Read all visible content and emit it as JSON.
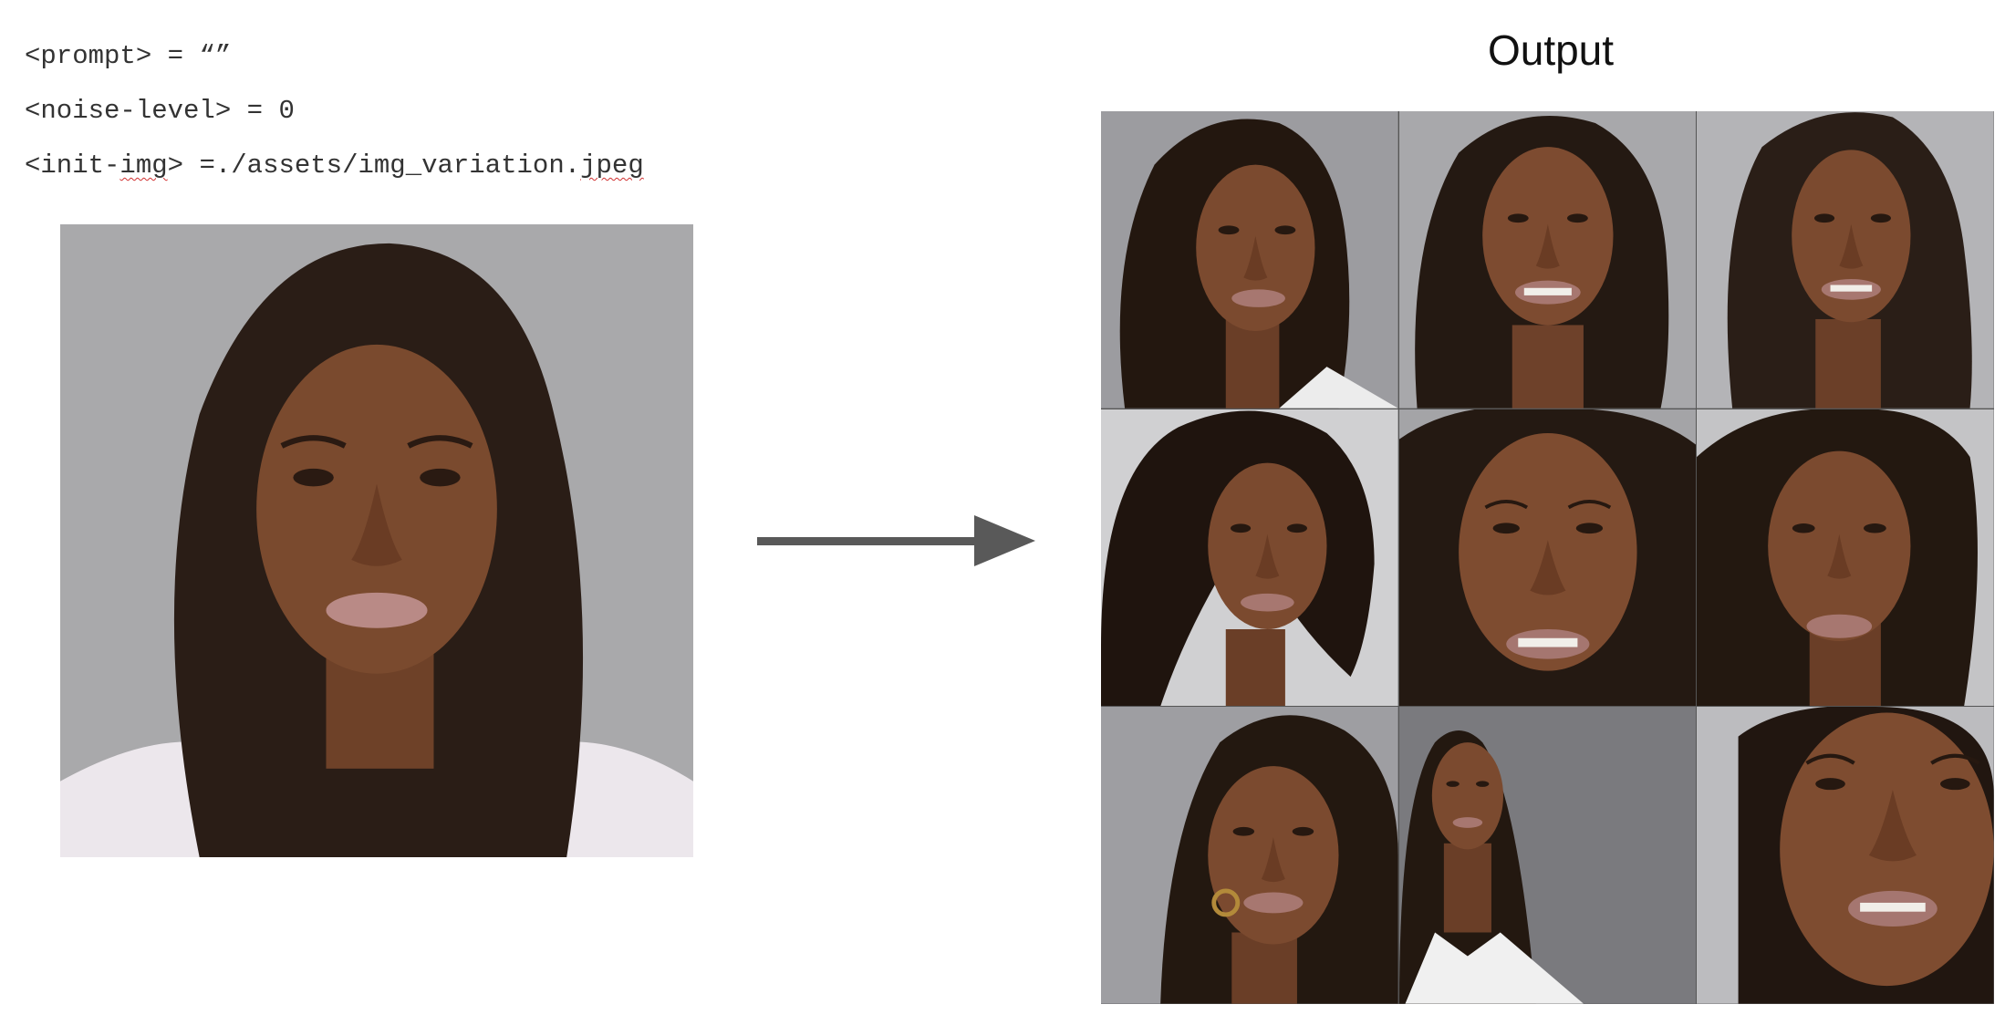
{
  "params": [
    {
      "name": "<prompt>",
      "op": " = ",
      "value": "“”"
    },
    {
      "name": "<noise-level>",
      "op": " = ",
      "value": "0"
    },
    {
      "name_pre": "<init-",
      "name_sq": "img",
      "name_post": ">",
      "op": " =",
      "value_pre": "./assets/img_variation.",
      "value_sq": "jpeg"
    }
  ],
  "output_title": "Output",
  "colors": {
    "background_gray": "#a9a9ab",
    "skin": "#7a4a2e",
    "hair": "#2a1d16",
    "arrow": "#595959"
  },
  "input_image": {
    "subject": "portrait of a woman, light gray background"
  },
  "output_images": [
    {
      "subject": "portrait variation 1"
    },
    {
      "subject": "portrait variation 2"
    },
    {
      "subject": "portrait variation 3"
    },
    {
      "subject": "portrait variation 4"
    },
    {
      "subject": "portrait variation 5"
    },
    {
      "subject": "portrait variation 6"
    },
    {
      "subject": "portrait variation 7"
    },
    {
      "subject": "portrait variation 8"
    },
    {
      "subject": "portrait variation 9"
    }
  ]
}
